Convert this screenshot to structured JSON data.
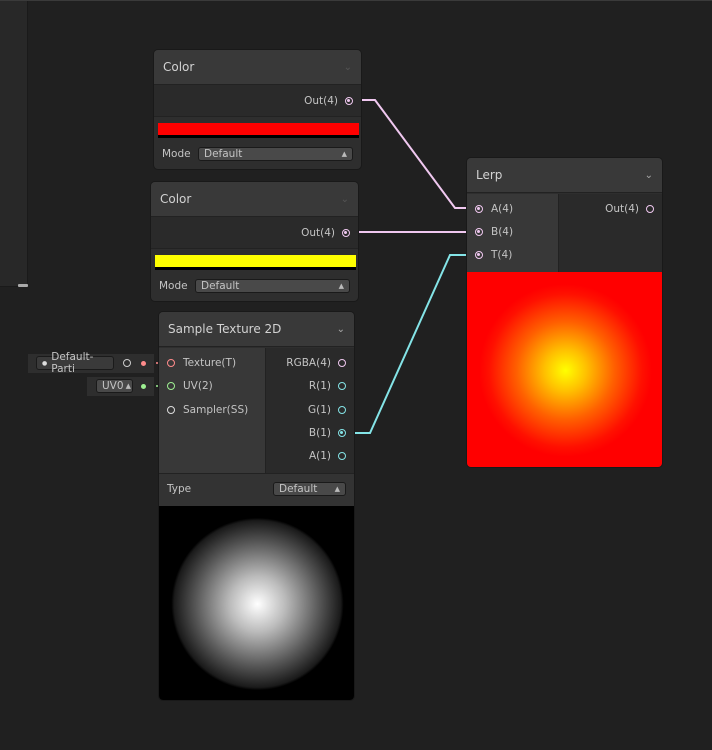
{
  "color_node_1": {
    "title": "Color",
    "output": "Out(4)",
    "swatch": "#ff0000",
    "mode_label": "Mode",
    "mode_value": "Default"
  },
  "color_node_2": {
    "title": "Color",
    "output": "Out(4)",
    "swatch": "#ffff00",
    "mode_label": "Mode",
    "mode_value": "Default"
  },
  "sample_texture": {
    "title": "Sample Texture 2D",
    "inputs": [
      "Texture(T)",
      "UV(2)",
      "Sampler(SS)"
    ],
    "outputs": [
      "RGBA(4)",
      "R(1)",
      "G(1)",
      "B(1)",
      "A(1)"
    ],
    "type_label": "Type",
    "type_value": "Default",
    "texture_field": "Default-Parti",
    "uv_field": "UV0"
  },
  "lerp": {
    "title": "Lerp",
    "inputs": [
      "A(4)",
      "B(4)",
      "T(4)"
    ],
    "output": "Out(4)"
  },
  "colors": {
    "background": "#202020",
    "node": "#2e2e2e",
    "header": "#393939",
    "vector4_port": "#f0c8f0",
    "float_port": "#84e4e7",
    "texture_port": "#ff8b8b",
    "uv_port": "#9ef092"
  }
}
